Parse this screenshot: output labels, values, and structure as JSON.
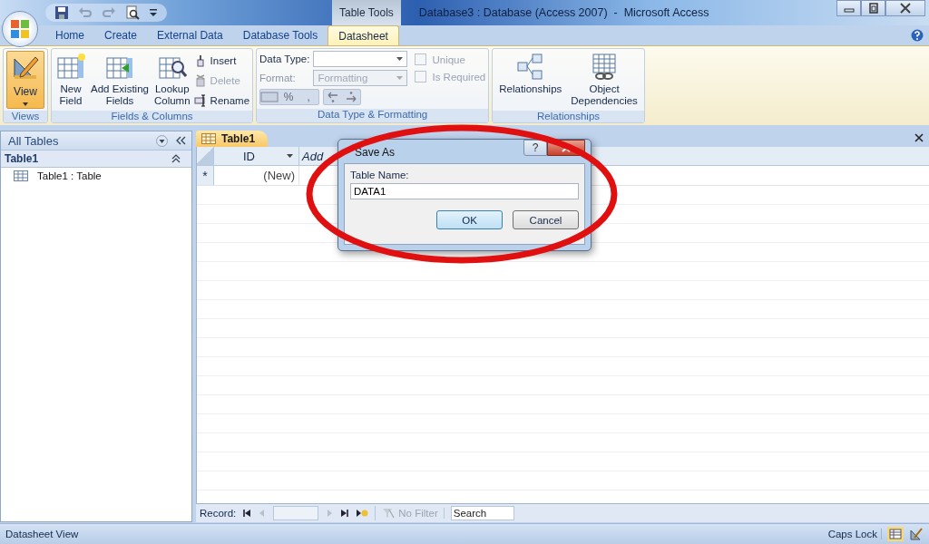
{
  "window": {
    "title": "Database3 : Database (Access 2007)  -  Microsoft Access",
    "context_tab_group": "Table Tools"
  },
  "ribbon_tabs": [
    {
      "label": "Home",
      "selected": false
    },
    {
      "label": "Create",
      "selected": false
    },
    {
      "label": "External Data",
      "selected": false
    },
    {
      "label": "Database Tools",
      "selected": false
    },
    {
      "label": "Datasheet",
      "selected": true
    }
  ],
  "views_group": {
    "label": "Views",
    "button": "View"
  },
  "fields_group": {
    "label": "Fields & Columns",
    "buttons": [
      {
        "kind": "new",
        "label": "New\nField"
      },
      {
        "kind": "existing",
        "label": "Add Existing\nFields"
      },
      {
        "kind": "lookup",
        "label": "Lookup\nColumn"
      }
    ],
    "small_buttons": [
      {
        "kind": "insert",
        "label": "Insert",
        "disabled": false
      },
      {
        "kind": "delete",
        "label": "Delete",
        "disabled": true
      },
      {
        "kind": "rename",
        "label": "Rename",
        "disabled": false
      }
    ]
  },
  "data_type_group": {
    "label": "Data Type & Formatting",
    "data_type_label": "Data Type:",
    "format_label": "Format:",
    "format_placeholder": "Formatting",
    "number_format_symbols": [
      "%",
      ","
    ],
    "checkboxes": [
      {
        "label": "Unique",
        "checked": false,
        "disabled": true
      },
      {
        "label": "Is Required",
        "checked": false,
        "disabled": true
      }
    ]
  },
  "relationships_group": {
    "label": "Relationships",
    "buttons": [
      {
        "kind": "relationships",
        "label": "Relationships"
      },
      {
        "kind": "dependencies",
        "label": "Object\nDependencies"
      }
    ]
  },
  "nav_pane": {
    "title": "All Tables",
    "group": "Table1",
    "items": [
      {
        "label": "Table1 : Table"
      }
    ]
  },
  "document_tab": {
    "label": "Table1"
  },
  "datasheet": {
    "columns": [
      "ID",
      "Add"
    ],
    "new_row": {
      "marker": "*",
      "id": "(New)"
    }
  },
  "record_nav": {
    "label": "Record:",
    "filter": "No Filter",
    "search_placeholder": "Search"
  },
  "dialog": {
    "title": "Save As",
    "help": "?",
    "field_label": "Table Name:",
    "value": "DATA1",
    "buttons": [
      {
        "label": "OK",
        "default": true
      },
      {
        "label": "Cancel",
        "default": false
      }
    ]
  },
  "status_bar": {
    "view": "Datasheet View",
    "caps_lock": "Caps Lock"
  }
}
